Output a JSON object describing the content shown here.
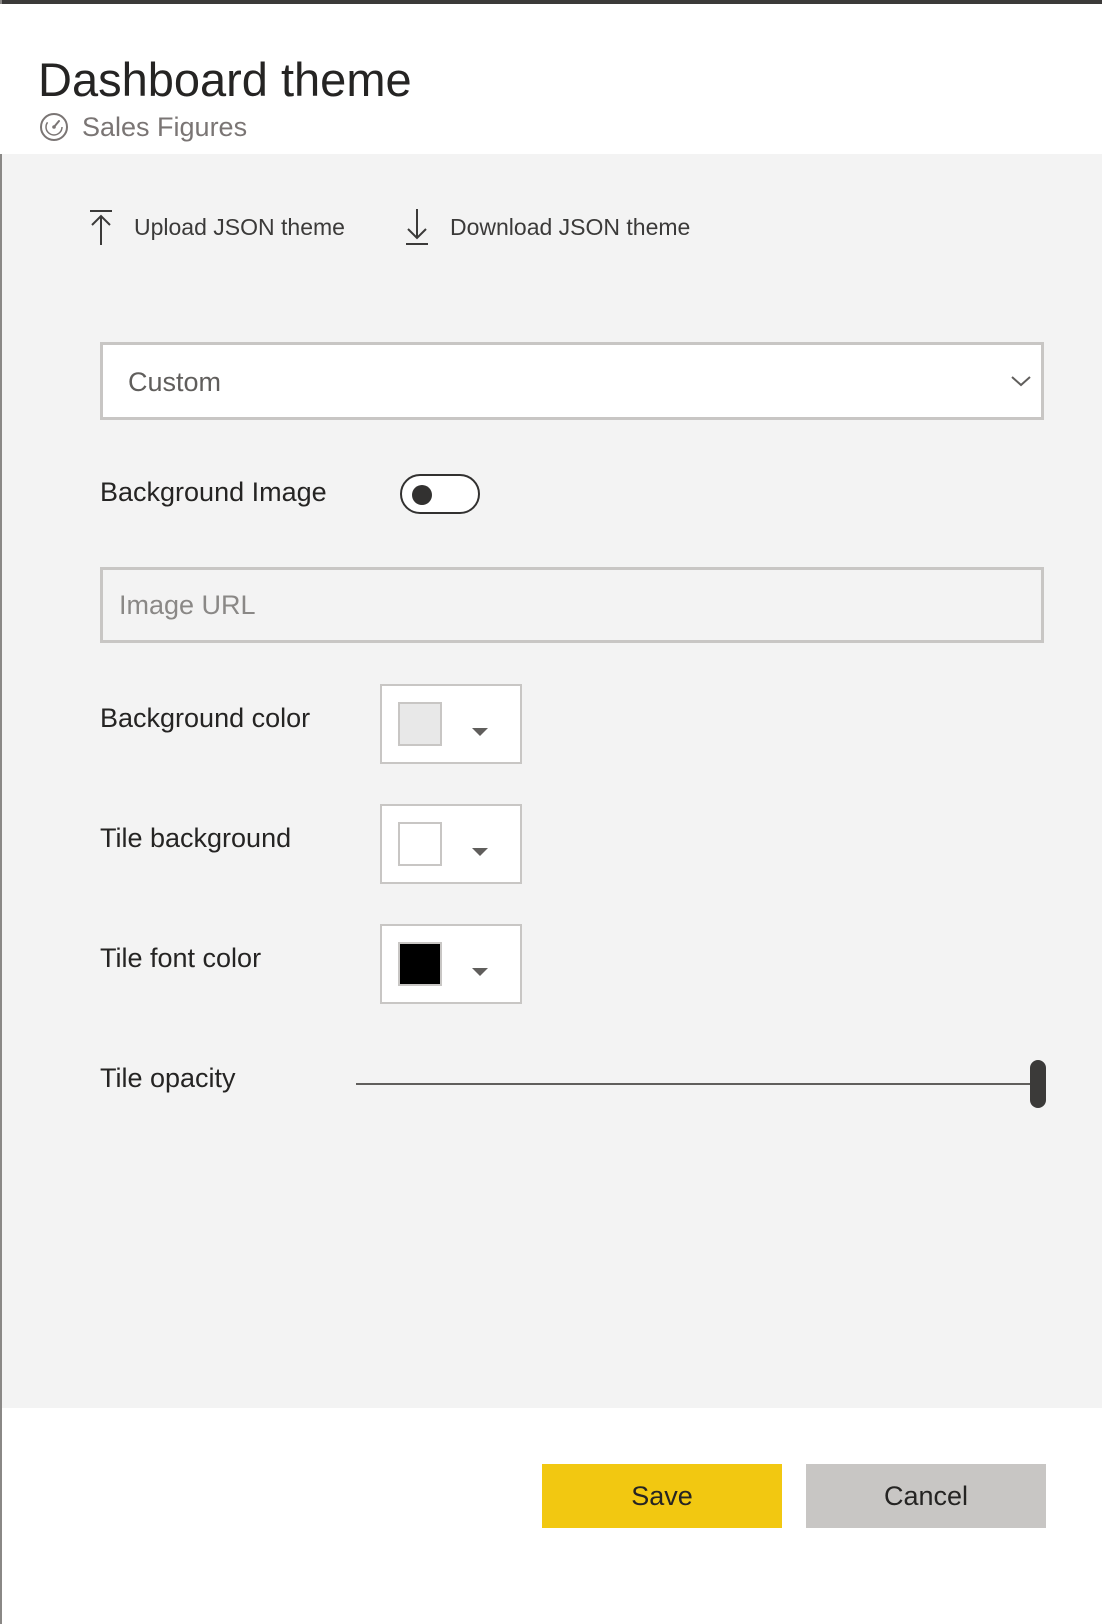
{
  "dialog": {
    "title": "Dashboard theme",
    "subtitle": "Sales Figures",
    "subtitle_icon": "dashboard-gauge-icon"
  },
  "actions": {
    "upload": {
      "label": "Upload JSON theme",
      "icon": "upload-arrow-icon"
    },
    "download": {
      "label": "Download JSON theme",
      "icon": "download-arrow-icon"
    }
  },
  "theme_select": {
    "value": "Custom",
    "icon": "chevron-down-icon"
  },
  "background_image": {
    "label": "Background Image",
    "enabled": false
  },
  "image_url": {
    "placeholder": "Image URL",
    "value": ""
  },
  "background_color": {
    "label": "Background color",
    "swatch": "#e8e8e8"
  },
  "tile_background": {
    "label": "Tile background",
    "swatch": "#ffffff"
  },
  "tile_font_color": {
    "label": "Tile font color",
    "swatch": "#000000"
  },
  "tile_opacity": {
    "label": "Tile opacity",
    "value_percent": 100
  },
  "footer": {
    "save_label": "Save",
    "cancel_label": "Cancel"
  },
  "colors": {
    "accent": "#f2c811",
    "panel": "#f3f3f3",
    "secondary_button": "#c8c6c4"
  }
}
